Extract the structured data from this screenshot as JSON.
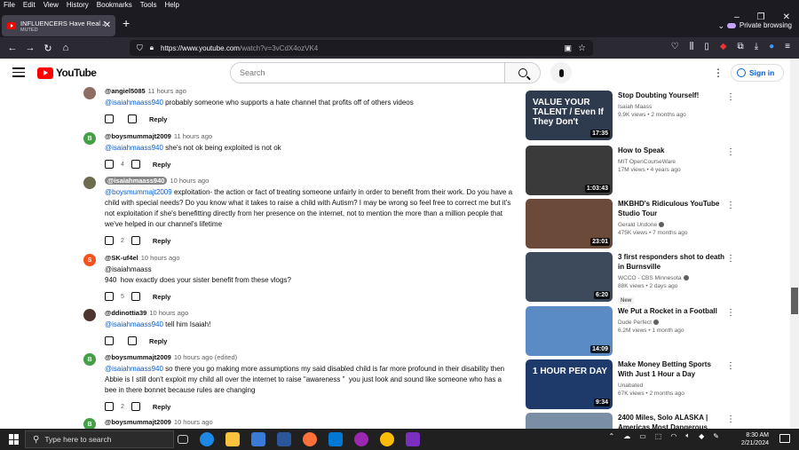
{
  "menubar": {
    "items": [
      "File",
      "Edit",
      "View",
      "History",
      "Bookmarks",
      "Tools",
      "Help"
    ]
  },
  "tab": {
    "title": "INFLUENCERS Have Real Jobs",
    "subtitle": "MUTED"
  },
  "browser": {
    "private_label": "Private browsing",
    "url_host": "https://www.youtube.com",
    "url_path": "/watch?v=3vCdX4ozVK4"
  },
  "youtube": {
    "logo_text": "YouTube",
    "search_placeholder": "Search",
    "signin_label": "Sign in"
  },
  "comments": [
    {
      "author": "@angiel5085",
      "time": "11 hours ago",
      "mention": "@isaiahmaass940",
      "text": " probably someone who supports a hate channel that profits off of others videos",
      "likes": "",
      "reply": "Reply",
      "avatar_letter": "",
      "avatar_color": "#8d6e63"
    },
    {
      "author": "@boysmummajt2009",
      "time": "11 hours ago",
      "mention": "@isaiahmaass940",
      "text": " she's not ok being exploited is not ok",
      "likes": "4",
      "reply": "Reply",
      "avatar_letter": "B",
      "avatar_color": "#43a047"
    },
    {
      "author": "@isaiahmaass940",
      "time": "10 hours ago",
      "mention": "@boysmummajt2009",
      "text": " exploitation- the action or fact of treating someone unfairly in order to benefit from their work. Do you have a child with special needs? Do you know what it takes to raise a child with Autism? I may be wrong so feel free to correct me but it's not exploitation if she's benefitting directly from her presence on the internet, not to mention the more than a million people that we've helped in our channel's lifetime",
      "likes": "2",
      "reply": "Reply",
      "avatar_letter": "",
      "avatar_color": "#6d6d4d"
    },
    {
      "author": "@SK-uf4el",
      "time": "10 hours ago",
      "mention": "",
      "text": "@isaiahmaass\n940  how exactly does your sister benefit from these vlogs?",
      "likes": "5",
      "reply": "Reply",
      "avatar_letter": "S",
      "avatar_color": "#f4511e"
    },
    {
      "author": "@ddinottia39",
      "time": "10 hours ago",
      "mention": "@isaiahmaass940",
      "text": " tell him Isaiah!",
      "likes": "",
      "reply": "Reply",
      "avatar_letter": "",
      "avatar_color": "#4e342e"
    },
    {
      "author": "@boysmummajt2009",
      "time": "10 hours ago (edited)",
      "mention": "@isaiahmaass940",
      "text": " so there you go making more assumptions my said disabled child is far more profound in their disability then Abbie is I still don't exploit my child all over the internet to raise \"awareness \"  you just look and sound like someone who has a bee in there bonnet because rules are changing",
      "likes": "2",
      "reply": "Reply",
      "avatar_letter": "B",
      "avatar_color": "#43a047"
    },
    {
      "author": "@boysmummajt2009",
      "time": "10 hours ago",
      "mention": "",
      "text": "",
      "likes": "",
      "reply": "",
      "avatar_letter": "B",
      "avatar_color": "#43a047"
    }
  ],
  "related": [
    {
      "title": "Stop Doubting Yourself!",
      "channel": "Isaiah Maass",
      "meta": "9.9K views • 2 months ago",
      "duration": "17:35",
      "overlay": "VALUE YOUR TALENT / Even If They Don't",
      "thumb_color": "#2e3b4e",
      "verified": false,
      "badge": ""
    },
    {
      "title": "How to Speak",
      "channel": "MIT OpenCourseWare",
      "meta": "17M views • 4 years ago",
      "duration": "1:03:43",
      "overlay": "",
      "thumb_color": "#3a3a3a",
      "verified": false,
      "badge": ""
    },
    {
      "title": "MKBHD's Ridiculous YouTube Studio Tour",
      "channel": "Gerald Undone",
      "meta": "475K views • 7 months ago",
      "duration": "23:01",
      "overlay": "",
      "thumb_color": "#6b4a3a",
      "verified": true,
      "badge": ""
    },
    {
      "title": "3 first responders shot to death in Burnsville",
      "channel": "WCCO - CBS Minnesota",
      "meta": "88K views • 2 days ago",
      "duration": "6:20",
      "overlay": "",
      "thumb_color": "#3c4a5c",
      "verified": true,
      "badge": "New"
    },
    {
      "title": "We Put a Rocket in a Football",
      "channel": "Dude Perfect",
      "meta": "6.2M views • 1 month ago",
      "duration": "14:09",
      "overlay": "",
      "thumb_color": "#5a8bc4",
      "verified": true,
      "badge": ""
    },
    {
      "title": "Make Money Betting Sports With Just 1 Hour a Day",
      "channel": "Unabated",
      "meta": "67K views • 2 months ago",
      "duration": "9:34",
      "overlay": "1 HOUR PER DAY",
      "thumb_color": "#1e3a6a",
      "verified": false,
      "badge": ""
    },
    {
      "title": "2400 Miles, Solo ALASKA | Americas Most Dangerous",
      "channel": "",
      "meta": "",
      "duration": "",
      "overlay": "",
      "thumb_color": "#7a8ea6",
      "verified": false,
      "badge": ""
    }
  ],
  "taskbar": {
    "search_placeholder": "Type here to search",
    "time": "8:30 AM",
    "date": "2/21/2024"
  }
}
